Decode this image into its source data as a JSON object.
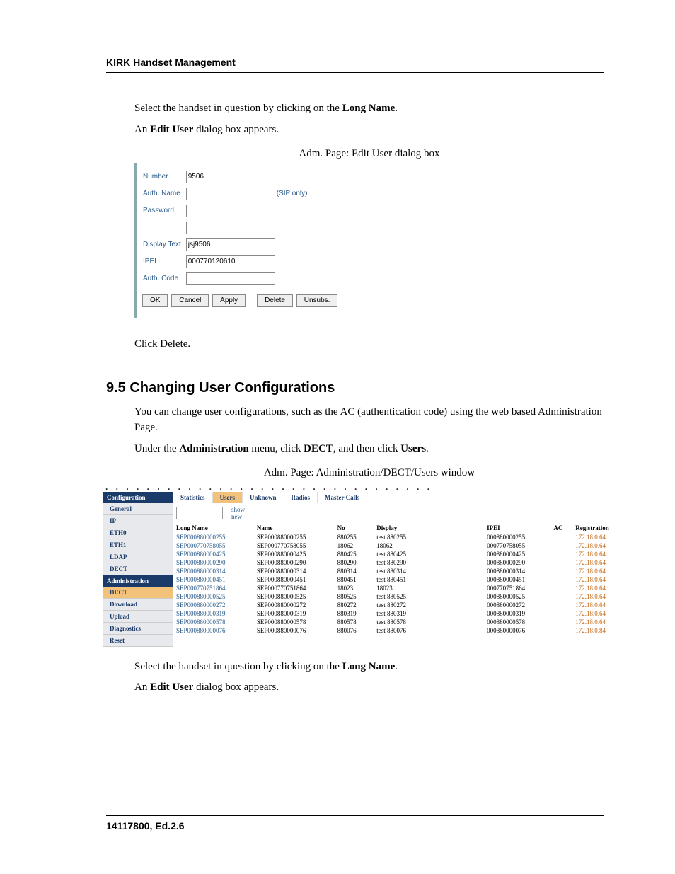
{
  "header": {
    "title": "KIRK Handset Management"
  },
  "body": {
    "p1a": "Select the handset in question by clicking on the ",
    "p1b": "Long Name",
    "p1c": ".",
    "p2a": "An ",
    "p2b": "Edit User",
    "p2c": " dialog box appears.",
    "fig1_caption": "Adm. Page: Edit User dialog box",
    "p3": "Click Delete.",
    "section": "9.5  Changing User Configurations",
    "p4": "You can change user configurations, such as the AC (authentication code) using the web based Administration Page.",
    "p5a": "Under the ",
    "p5b": "Administration",
    "p5c": " menu, click ",
    "p5d": "DECT",
    "p5e": ", and then click ",
    "p5f": "Users",
    "p5g": ".",
    "fig2_caption": "Adm. Page: Administration/DECT/Users window",
    "p6a": "Select the handset in question by clicking on the ",
    "p6b": "Long Name",
    "p6c": ".",
    "p7a": "An ",
    "p7b": "Edit User",
    "p7c": " dialog box appears."
  },
  "fig1": {
    "labels": {
      "number": "Number",
      "auth_name": "Auth. Name",
      "password": "Password",
      "display_text": "Display Text",
      "ipei": "IPEI",
      "auth_code": "Auth. Code",
      "sip_only": "(SIP only)"
    },
    "values": {
      "number": "9506",
      "auth_name": "",
      "password": "",
      "password2": "",
      "display_text": "jsj9506",
      "ipei": "000770120610",
      "auth_code": ""
    },
    "buttons": {
      "ok": "OK",
      "cancel": "Cancel",
      "apply": "Apply",
      "delete": "Delete",
      "unsubs": "Unsubs."
    }
  },
  "fig2": {
    "leftnav": {
      "hdr1": "Configuration",
      "items1": [
        "General",
        "IP",
        "ETH0",
        "ETH1",
        "LDAP",
        "DECT"
      ],
      "hdr2": "Administration",
      "items2": [
        "DECT",
        "Download",
        "Upload",
        "Diagnostics",
        "Reset"
      ],
      "active_item": "DECT"
    },
    "tabs": [
      "Statistics",
      "Users",
      "Unknown",
      "Radios",
      "Master Calls"
    ],
    "active_tab": "Users",
    "sublinks": {
      "show": "show",
      "new": "new"
    },
    "columns": [
      "Long Name",
      "Name",
      "No",
      "Display",
      "IPEI",
      "AC",
      "Registration"
    ],
    "rows": [
      {
        "long": "SEP000880000255",
        "name": "SEP000880000255",
        "no": "880255",
        "display": "test 880255",
        "ipei": "000880000255",
        "ac": "",
        "reg": "172.18.0.64"
      },
      {
        "long": "SEP000770758055",
        "name": "SEP000770758055",
        "no": "18062",
        "display": "18062",
        "ipei": "000770758055",
        "ac": "",
        "reg": "172.18.0.64"
      },
      {
        "long": "SEP000880000425",
        "name": "SEP000880000425",
        "no": "880425",
        "display": "test 880425",
        "ipei": "000880000425",
        "ac": "",
        "reg": "172.18.0.64"
      },
      {
        "long": "SEP000880000290",
        "name": "SEP000880000290",
        "no": "880290",
        "display": "test 880290",
        "ipei": "000880000290",
        "ac": "",
        "reg": "172.18.0.64"
      },
      {
        "long": "SEP000880000314",
        "name": "SEP000880000314",
        "no": "880314",
        "display": "test 880314",
        "ipei": "000880000314",
        "ac": "",
        "reg": "172.18.0.64"
      },
      {
        "long": "SEP000880000451",
        "name": "SEP000880000451",
        "no": "880451",
        "display": "test 880451",
        "ipei": "000880000451",
        "ac": "",
        "reg": "172.18.0.64"
      },
      {
        "long": "SEP000770751864",
        "name": "SEP000770751864",
        "no": "18023",
        "display": "18023",
        "ipei": "000770751864",
        "ac": "",
        "reg": "172.18.0.64"
      },
      {
        "long": "SEP000880000525",
        "name": "SEP000880000525",
        "no": "880525",
        "display": "test 880525",
        "ipei": "000880000525",
        "ac": "",
        "reg": "172.18.0.64"
      },
      {
        "long": "SEP000880000272",
        "name": "SEP000880000272",
        "no": "880272",
        "display": "test 880272",
        "ipei": "000880000272",
        "ac": "",
        "reg": "172.18.0.64"
      },
      {
        "long": "SEP000880000319",
        "name": "SEP000880000319",
        "no": "880319",
        "display": "test 880319",
        "ipei": "000880000319",
        "ac": "",
        "reg": "172.18.0.64"
      },
      {
        "long": "SEP000880000578",
        "name": "SEP000880000578",
        "no": "880578",
        "display": "test 880578",
        "ipei": "000880000578",
        "ac": "",
        "reg": "172.18.0.64"
      },
      {
        "long": "SEP000880000076",
        "name": "SEP000880000076",
        "no": "880076",
        "display": "test 880076",
        "ipei": "000880000076",
        "ac": "",
        "reg": "172.18.0.84"
      }
    ]
  },
  "footer": {
    "text": "14117800, Ed.2.6"
  }
}
